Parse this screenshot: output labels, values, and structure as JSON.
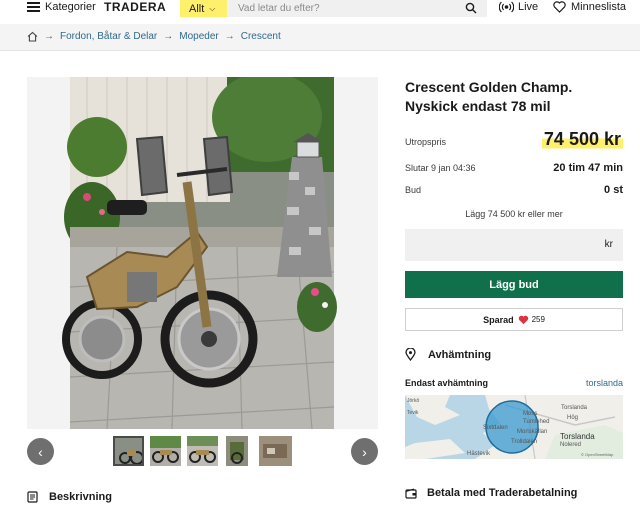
{
  "header": {
    "categories_label": "Kategorier",
    "logo": "TRADERA",
    "scope_label": "Allt",
    "search_placeholder": "Vad letar du efter?",
    "live_label": "Live",
    "wishlist_label": "Minneslista"
  },
  "breadcrumb": {
    "items": [
      "Fordon, Båtar & Delar",
      "Mopeder",
      "Crescent"
    ]
  },
  "listing": {
    "title": "Crescent Golden Champ. Nyskick endast 78 mil",
    "price_label": "Utropspris",
    "price": "74 500 kr",
    "end_label": "Slutar 9 jan 04:36",
    "time_left": "20 tim 47 min",
    "bids_label": "Bud",
    "bids_count": "0 st",
    "bid_hint": "Lägg 74 500 kr eller mer",
    "bid_unit": "kr",
    "bid_button": "Lägg bud",
    "save_label": "Sparad",
    "save_count": "259"
  },
  "pickup": {
    "heading": "Avhämtning",
    "only_pickup": "Endast avhämtning",
    "location": "torslanda",
    "map_labels": [
      "Jörkö",
      "Tevik",
      "Torslanda",
      "Hög",
      "Moss",
      "Tumlehed",
      "Sixtdalen",
      "Moriskällan",
      "Torslanda",
      "Trolldalen",
      "Nolered",
      "Hästevik",
      "© OpenStreetMap"
    ]
  },
  "payment": {
    "heading": "Betala med Traderabetalning"
  },
  "description": {
    "heading": "Beskrivning"
  },
  "icons": {
    "menu": "hamburger-icon",
    "search": "search-icon",
    "live": "live-broadcast-icon",
    "wishlist": "heart-outline-icon",
    "home": "home-icon",
    "pin": "location-pin-icon",
    "wallet": "wallet-icon",
    "doc": "document-icon"
  },
  "colors": {
    "accent_yellow": "#fff06b",
    "bid_green": "#11704c",
    "link_blue": "#2f6a8c"
  }
}
